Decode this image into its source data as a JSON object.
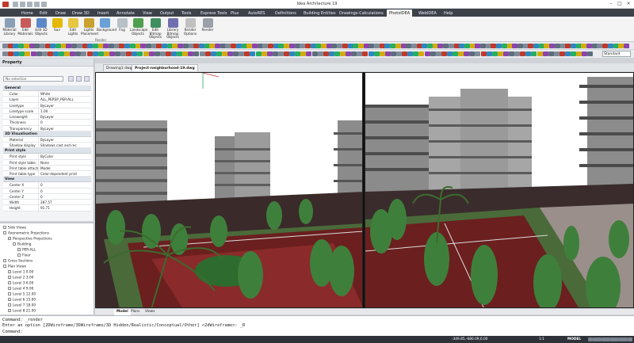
{
  "app_title": "Idea Architecture 19",
  "ribbon_tabs": [
    "Home",
    "Edit",
    "Draw",
    "Draw 3D",
    "Insert",
    "Annotate",
    "View",
    "Output",
    "Tools",
    "Express Tools",
    "Plus",
    "AutoRES",
    "Definitions",
    "Building Entities",
    "Drawings-Calculations",
    "PhotoIDEA",
    "WebIDEA",
    "Help"
  ],
  "active_tab": "PhotoIDEA",
  "ribbon_buttons": [
    "Material Library",
    "Edit Materials",
    "Edit 3D Objects",
    "Sun",
    "Edit Lights",
    "Lights Placement",
    "Background",
    "Fog",
    "Landscape Objects",
    "Edit Bitmap Objects",
    "Library Bitmap Objects",
    "Render Options",
    "Render"
  ],
  "ribbon_group": "Render",
  "style_select": "Standard",
  "property": {
    "title": "Property",
    "selection": "No selection",
    "sections": [
      {
        "name": "General",
        "rows": [
          [
            "Color",
            "White"
          ],
          [
            "Layer",
            "ALL_PERSP_PER-ALL"
          ],
          [
            "Linetype",
            "ByLayer"
          ],
          [
            "Linetype scale",
            "1.00"
          ],
          [
            "Lineweight",
            "ByLayer"
          ],
          [
            "Thickness",
            "0"
          ],
          [
            "Transparency",
            "ByLayer"
          ]
        ]
      },
      {
        "name": "3D Visualisation",
        "rows": [
          [
            "Material",
            "ByLayer"
          ],
          [
            "Shadow display",
            "Shadows cast and rec"
          ]
        ]
      },
      {
        "name": "Print style",
        "rows": [
          [
            "Print style",
            "ByColor"
          ],
          [
            "Print style table",
            "None"
          ],
          [
            "Print table attached to",
            "Model"
          ],
          [
            "Print table type",
            "Color-dependent print"
          ]
        ]
      },
      {
        "name": "View",
        "rows": [
          [
            "Center X",
            "0"
          ],
          [
            "Center Y",
            "0"
          ],
          [
            "Center Z",
            "0"
          ],
          [
            "Width",
            "287.57"
          ],
          [
            "Height",
            "91.71"
          ]
        ]
      }
    ]
  },
  "tree": [
    "Side Views",
    "Axonometric Projections",
    "Perspective Projections",
    "Building",
    "PER-ALL",
    "Floor",
    "Cross Sections",
    "Plan Views",
    "Level 1  0.00",
    "Level 2  3.00",
    "Level 3  6.00",
    "Level 4  9.00",
    "Level 5  12.00",
    "Level 6  15.00",
    "Level 7  18.00",
    "Level 8  21.00"
  ],
  "doc_tabs": [
    "Drawing1.dwg",
    "Project-neighborhood-19.dwg"
  ],
  "active_doc": "Project-neighborhood-19.dwg",
  "layout_tabs": [
    "Model",
    "Plans",
    "Views"
  ],
  "command_lines": [
    "Command: _render",
    "Enter an option [2DWireframe/3DWireframe/3D Hidden/Realistic/Conceptual/Other] <2dWireframe>: _R",
    "Command:"
  ],
  "status": {
    "coords": "-349.85,-686.09,0.00",
    "scale": "1:1",
    "mode": "MODEL"
  },
  "colors": {
    "ribbon_dark": "#3d4249",
    "court": "#6b1f1f",
    "sky": "#ffffff",
    "tree": "#3f7f3c"
  }
}
